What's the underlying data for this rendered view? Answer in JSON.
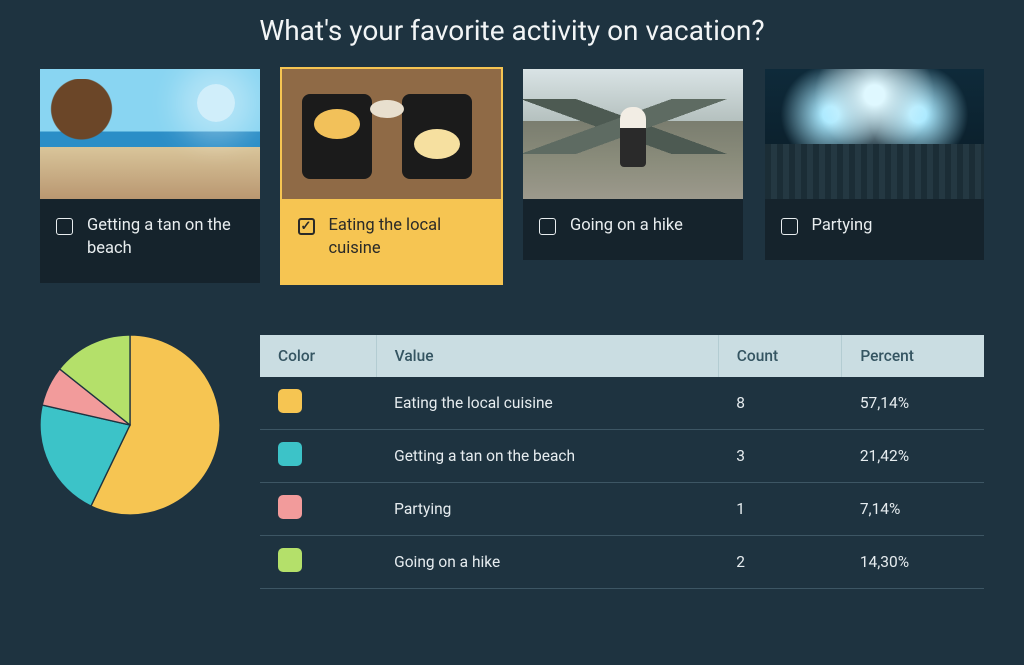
{
  "title": "What's your favorite activity on vacation?",
  "options": [
    {
      "label": "Getting a tan on the beach",
      "selected": false,
      "image": "beach"
    },
    {
      "label": "Eating the local cuisine",
      "selected": true,
      "image": "food"
    },
    {
      "label": "Going on a hike",
      "selected": false,
      "image": "hike"
    },
    {
      "label": "Partying",
      "selected": false,
      "image": "party"
    }
  ],
  "table": {
    "headers": {
      "color": "Color",
      "value": "Value",
      "count": "Count",
      "percent": "Percent"
    },
    "rows": [
      {
        "color": "#f6c552",
        "cls": "val-yellow",
        "value": "Eating the local cuisine",
        "count": "8",
        "percent": "57,14%"
      },
      {
        "color": "#3cc3c8",
        "cls": "val-teal",
        "value": "Getting a tan on the beach",
        "count": "3",
        "percent": "21,42%"
      },
      {
        "color": "#f29b9b",
        "cls": "val-pink",
        "value": "Partying",
        "count": "1",
        "percent": "7,14%"
      },
      {
        "color": "#b4e06a",
        "cls": "val-green",
        "value": "Going on a hike",
        "count": "2",
        "percent": "14,30%"
      }
    ]
  },
  "chart_data": {
    "type": "pie",
    "title": "What's your favorite activity on vacation?",
    "series": [
      {
        "name": "Eating the local cuisine",
        "value": 8,
        "percent": 57.14,
        "color": "#f6c552"
      },
      {
        "name": "Getting a tan on the beach",
        "value": 3,
        "percent": 21.42,
        "color": "#3cc3c8"
      },
      {
        "name": "Partying",
        "value": 1,
        "percent": 7.14,
        "color": "#f29b9b"
      },
      {
        "name": "Going on a hike",
        "value": 2,
        "percent": 14.3,
        "color": "#b4e06a"
      }
    ]
  }
}
